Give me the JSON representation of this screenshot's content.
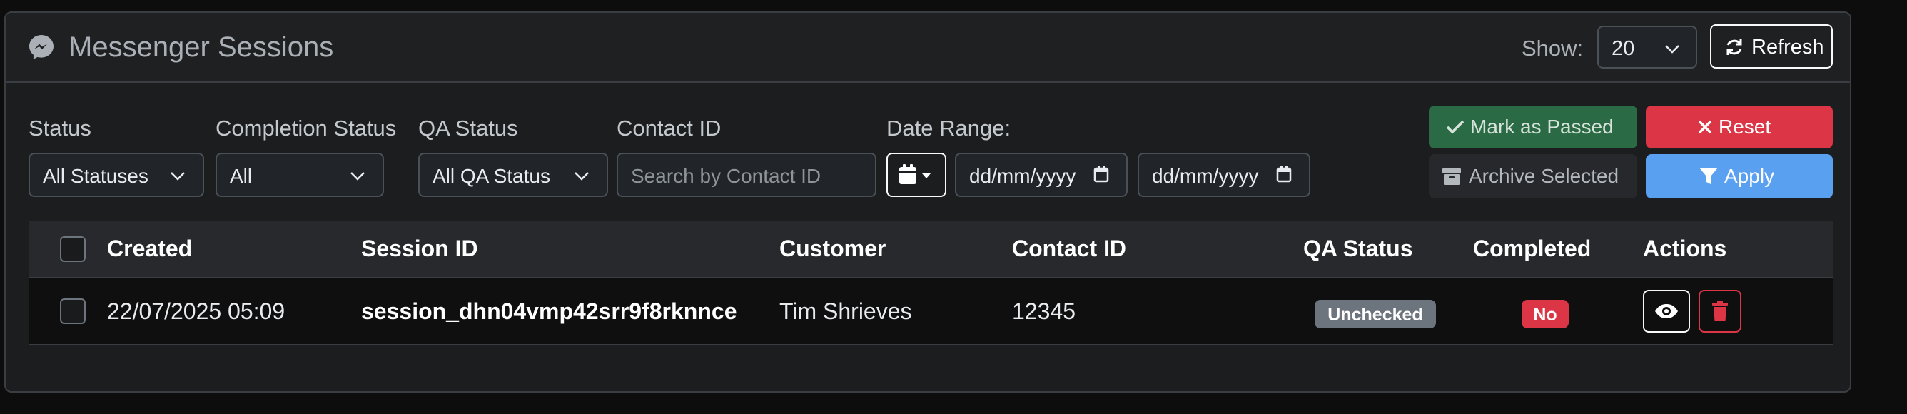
{
  "header": {
    "title": "Messenger Sessions",
    "show_label": "Show:",
    "page_size": "20",
    "refresh_label": "Refresh"
  },
  "filters": {
    "status": {
      "label": "Status",
      "value": "All Statuses"
    },
    "completion": {
      "label": "Completion Status",
      "value": "All"
    },
    "qa": {
      "label": "QA Status",
      "value": "All QA Status"
    },
    "contact": {
      "label": "Contact ID",
      "placeholder": "Search by Contact ID"
    },
    "date_range": {
      "label": "Date Range:",
      "from": "dd/mm/yyyy",
      "to": "dd/mm/yyyy"
    }
  },
  "actions": {
    "mark_passed": "Mark as Passed",
    "reset": "Reset",
    "archive": "Archive Selected",
    "apply": "Apply"
  },
  "table": {
    "columns": [
      "Created",
      "Session ID",
      "Customer",
      "Contact ID",
      "QA Status",
      "Completed",
      "Actions"
    ],
    "rows": [
      {
        "created": "22/07/2025 05:09",
        "session_id": "session_dhn04vmp42srr9f8rknnce",
        "customer": "Tim Shrieves",
        "contact_id": "12345",
        "qa_status": "Unchecked",
        "completed": "No"
      }
    ]
  },
  "icons": {
    "header": "messenger-icon",
    "refresh": "refresh-icon",
    "calendar": "calendar-icon",
    "check": "check-icon",
    "times": "x-icon",
    "archive": "archive-icon",
    "filter": "filter-icon",
    "view": "eye-icon",
    "delete": "trash-icon"
  },
  "colors": {
    "success": "#2a6a45",
    "danger": "#dc3545",
    "primary": "#5aa0f0",
    "secondary": "#6c757d"
  }
}
